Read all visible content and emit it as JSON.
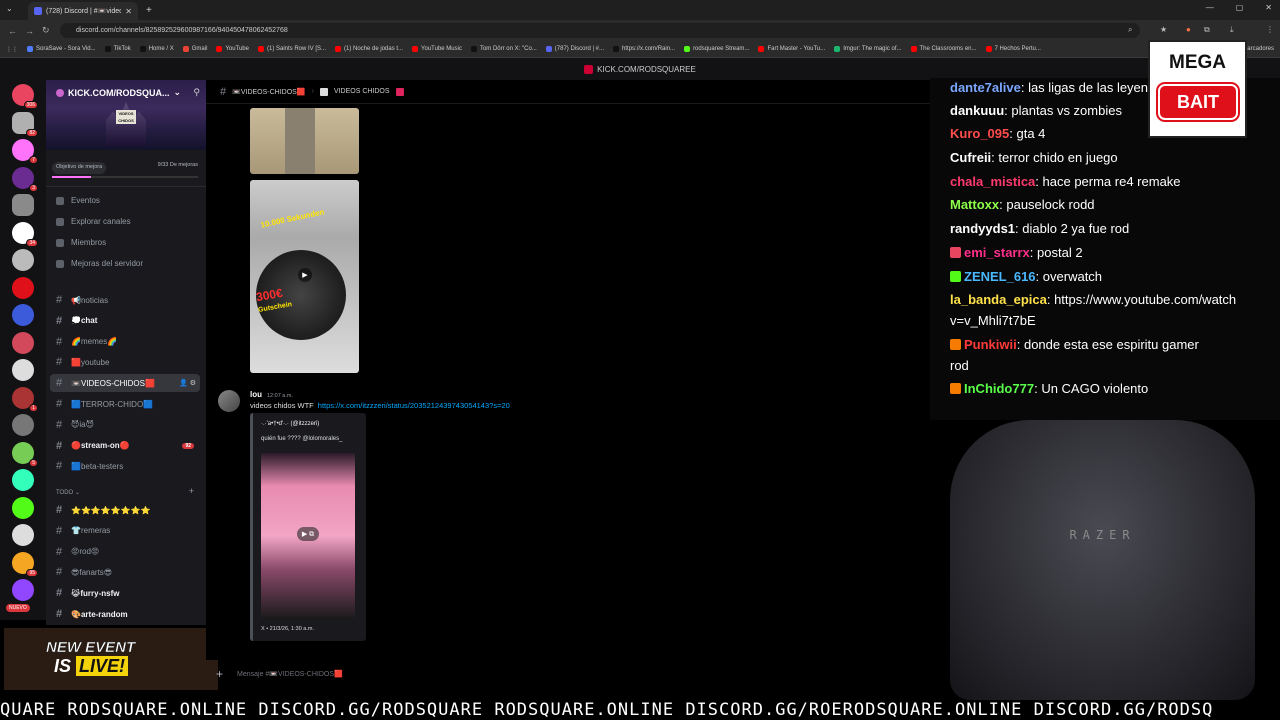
{
  "browser": {
    "tab_title": "(728) Discord | #📼videos-chid",
    "url": "discord.com/channels/825892529600987166/940450478062452768",
    "bookmarks": [
      {
        "label": "SoraSave - Sora Vid...",
        "color": "#4f7cff"
      },
      {
        "label": "TikTok",
        "color": "#111111"
      },
      {
        "label": "Home / X",
        "color": "#111111"
      },
      {
        "label": "Gmail",
        "color": "#ea4335"
      },
      {
        "label": "YouTube",
        "color": "#ff0000"
      },
      {
        "label": "(1) Saints Row IV [S...",
        "color": "#ff0000"
      },
      {
        "label": "(1) Noche de jodas t...",
        "color": "#ff0000"
      },
      {
        "label": "YouTube Music",
        "color": "#ff0000"
      },
      {
        "label": "Tom Dörr on X: \"Co...",
        "color": "#111111"
      },
      {
        "label": "(787) Discord | #...",
        "color": "#5865f2"
      },
      {
        "label": "https://x.com/Rain...",
        "color": "#111111"
      },
      {
        "label": "rodsquaree Stream...",
        "color": "#53fc18"
      },
      {
        "label": "Fart Master - YouTu...",
        "color": "#ff0000"
      },
      {
        "label": "Imgur: The magic of...",
        "color": "#1bb76e"
      },
      {
        "label": "The Classrooms en...",
        "color": "#ff0000"
      },
      {
        "label": "7 Hechos Pertu...",
        "color": "#ff0000"
      }
    ],
    "bookmarks_folder": "Marcadores"
  },
  "kick_bar": "KICK.COM/RODSQUAREE",
  "servers": [
    {
      "badge": "306",
      "color": "#e94560"
    },
    {
      "badge": "82",
      "color": "#b0b0b0"
    },
    {
      "badge": "7",
      "color": "#ff73fa"
    },
    {
      "badge": "3",
      "color": "#6a2c91"
    },
    {
      "badge": "",
      "color": "#8a8a8a"
    },
    {
      "badge": "34",
      "color": "#ffffff"
    },
    {
      "badge": "",
      "color": "#bbbbbb"
    },
    {
      "badge": "",
      "color": "#e0101a"
    },
    {
      "badge": "",
      "color": "#3b5bdb"
    },
    {
      "badge": "",
      "color": "#d1495b"
    },
    {
      "badge": "",
      "color": "#dddddd"
    },
    {
      "badge": "1",
      "color": "#a33"
    },
    {
      "badge": "",
      "color": "#777"
    },
    {
      "badge": "5",
      "color": "#7c5"
    },
    {
      "badge": "",
      "color": "#3fb"
    },
    {
      "badge": "",
      "color": "#53fc18"
    },
    {
      "badge": "",
      "color": "#ddd"
    },
    {
      "badge": "95",
      "color": "#f5a623"
    },
    {
      "badge": "",
      "color": "#9146ff"
    }
  ],
  "nuevo": "NUEVO",
  "guild": {
    "name": "KICK.COM/RODSQUA...",
    "banner_sign": "VIDEOS CHIDOS",
    "boost_goal": "Objetivo de mejora",
    "boost_count": "9/33 De mejoras",
    "boost_fraction": 0.27
  },
  "menu": [
    {
      "label": "Eventos"
    },
    {
      "label": "Explorar canales"
    },
    {
      "label": "Miembros"
    },
    {
      "label": "Mejoras del servidor"
    }
  ],
  "channels": [
    {
      "label": "📢noticias",
      "state": "normal"
    },
    {
      "label": "💭chat",
      "state": "bold"
    },
    {
      "label": "🌈memes🌈",
      "state": "normal"
    },
    {
      "label": "🟥youtube",
      "state": "normal"
    },
    {
      "label": "📼VIDEOS-CHIDOS🟥",
      "state": "active"
    },
    {
      "label": "🟦TERROR-CHIDO🟦",
      "state": "normal"
    },
    {
      "label": "😈ia😈",
      "state": "normal"
    },
    {
      "label": "🔴stream-on🔴",
      "state": "bold",
      "count": "92"
    },
    {
      "label": "🟦beta-testers",
      "state": "normal"
    }
  ],
  "category": "TODO",
  "channels2": [
    {
      "label": "⭐⭐⭐⭐⭐⭐⭐⭐",
      "state": "bold"
    },
    {
      "label": "👕remeras",
      "state": "normal"
    },
    {
      "label": "😡rod😡",
      "state": "normal"
    },
    {
      "label": "😎fanarts😎",
      "state": "normal"
    },
    {
      "label": "😹furry-nsfw",
      "state": "bold"
    },
    {
      "label": "🎨arte-random",
      "state": "bold"
    }
  ],
  "chat": {
    "header_channel": "📼VIDEOS-CHIDOS🟥",
    "header_thread": "VIDEOS CHIDOS",
    "img2_text1": "10.000 Sekunden",
    "img2_text2": "300€",
    "img2_text3": "Gutschein",
    "message": {
      "author": "lou",
      "time": "12:07 a.m.",
      "text": "videos chidos WTF",
      "link": "https://x.com/itzzzeri/status/2035212439743054143?s=20"
    },
    "embed": {
      "author": "·.·'a•†•d'·.· (@itzzzeri)",
      "desc": "quién fue ???? @lolomorales_",
      "footer": "X • 21/3/26, 1:30 a.m."
    },
    "composer_placeholder": "Mensaje #📼VIDEOS-CHIDOS🟥"
  },
  "stream_chat": [
    {
      "user": "dante7alive",
      "msg": "las ligas de las leyen",
      "color": "#7aa7ff",
      "badge": ""
    },
    {
      "user": "dankuuu",
      "msg": "plantas vs zombies",
      "color": "#ffffff",
      "badge": ""
    },
    {
      "user": "Kuro_095",
      "msg": "gta 4",
      "color": "#ff4d4d",
      "badge": ""
    },
    {
      "user": "Cufreii",
      "msg": "terror chido en juego",
      "color": "#ffffff",
      "badge": ""
    },
    {
      "user": "chala_mistica",
      "msg": "hace perma re4 remake",
      "color": "#ff3a6e",
      "badge": ""
    },
    {
      "user": "Mattoxx",
      "msg": "pauselock rodd",
      "color": "#8cff4a",
      "badge": ""
    },
    {
      "user": "randyyds1",
      "msg": "diablo 2 ya fue rod",
      "color": "#ffffff",
      "badge": ""
    },
    {
      "user": "emi_starrx",
      "msg": "postal 2",
      "color": "#ff2e8a",
      "badge": "#e94560"
    },
    {
      "user": "ZENEL_616",
      "msg": "overwatch",
      "color": "#4ab8ff",
      "badge": "#53fc18"
    },
    {
      "user": "la_banda_epica",
      "msg": "https://www.youtube.com/watch",
      "color": "#ffe14a",
      "badge": ""
    },
    {
      "user": "",
      "msg": "v=v_Mhli7t7bE",
      "color": "#ffffff",
      "badge": ""
    },
    {
      "user": "Punkiwii",
      "msg": "donde esta ese espiritu gamer",
      "color": "#ff3a3a",
      "badge": "#f57c00"
    },
    {
      "user": "",
      "msg": "rod",
      "color": "#ffffff",
      "badge": ""
    },
    {
      "user": "InChido777",
      "msg": "Un CAGO violento",
      "color": "#5aff4a",
      "badge": "#f57c00"
    }
  ],
  "megabait": {
    "line1": "MEGA",
    "line2": "BAIT"
  },
  "chair_logo": "RAZER",
  "event": {
    "line1": "NEW EVENT",
    "line2a": "IS ",
    "line2b": "LIVE!"
  },
  "ticker": "QUARE RODSQUARE.ONLINE DISCORD.GG/RODSQUARE RODSQUARE.ONLINE DISCORD.GG/ROERODSQUARE.ONLINE DISCORD.GG/RODSQ"
}
